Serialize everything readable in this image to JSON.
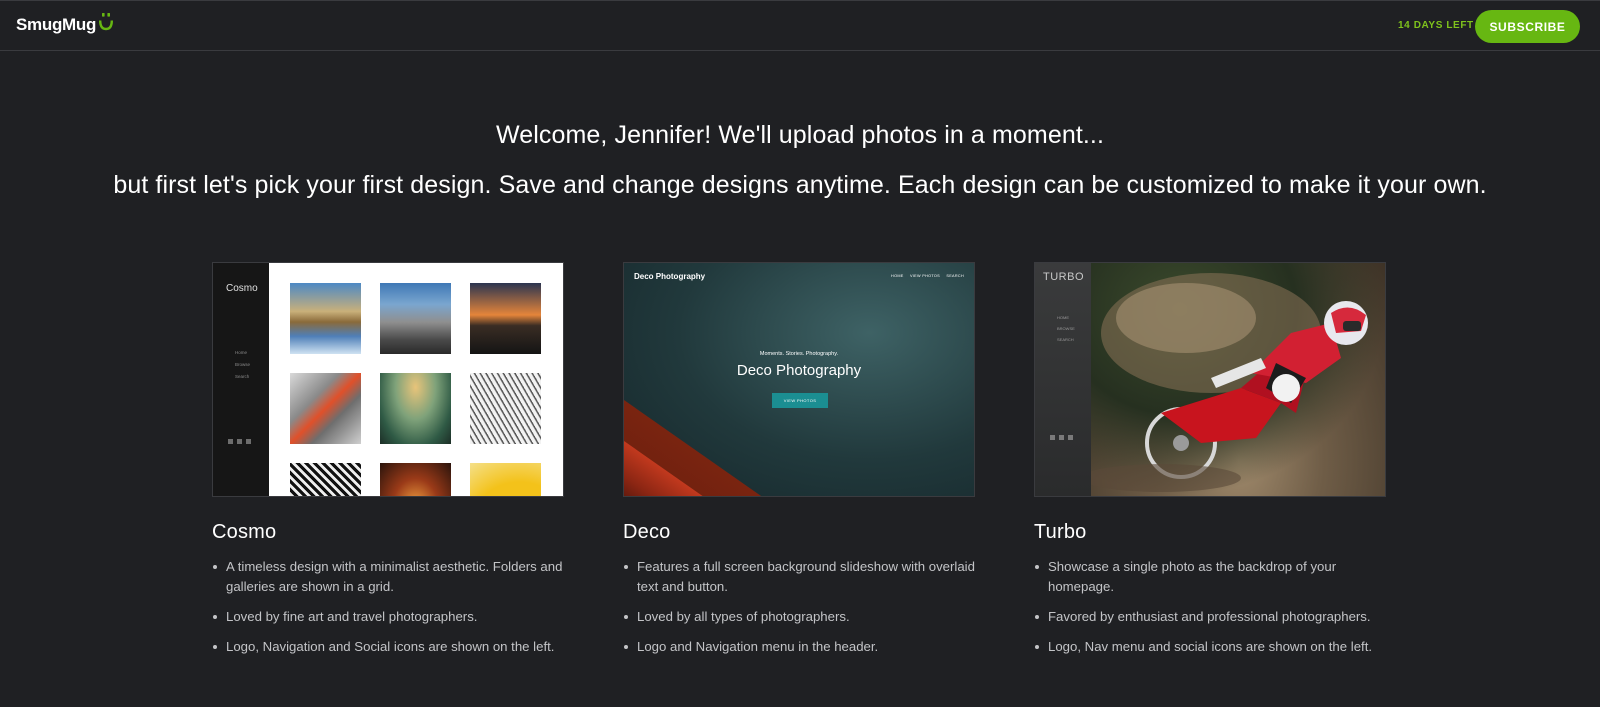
{
  "header": {
    "logo_text": "SmugMug",
    "trial_label": "14 DAYS LEFT",
    "subscribe_label": "SUBSCRIBE",
    "colors": {
      "accent": "#67b712",
      "trial_text": "#7fc31c",
      "background": "#1f2023"
    }
  },
  "welcome": {
    "line1": "Welcome, Jennifer! We'll upload photos in a moment...",
    "line2": "but first let's pick your first design. Save and change designs anytime. Each design can be customized to make it your own."
  },
  "designs": [
    {
      "name": "Cosmo",
      "preview": {
        "logo": "Cosmo",
        "nav": [
          "Home",
          "Browse",
          "Search"
        ]
      },
      "features": [
        "A timeless design with a minimalist aesthetic. Folders and galleries are shown in a grid.",
        "Loved by fine art and travel photographers.",
        "Logo, Navigation and Social icons are shown on the left."
      ]
    },
    {
      "name": "Deco",
      "preview": {
        "brand": "Deco Photography",
        "nav": [
          "HOME",
          "VIEW PHOTOS",
          "SEARCH"
        ],
        "tagline": "Moments. Stories. Photography.",
        "title": "Deco Photography",
        "button": "VIEW PHOTOS"
      },
      "features": [
        "Features a full screen background slideshow with overlaid text and button.",
        "Loved by all types of photographers.",
        "Logo and Navigation menu in the header."
      ]
    },
    {
      "name": "Turbo",
      "preview": {
        "logo": "TURBO",
        "nav": [
          "HOME",
          "BROWSE",
          "SEARCH"
        ]
      },
      "features": [
        "Showcase a single photo as the backdrop of your homepage.",
        "Favored by enthusiast and professional photographers.",
        "Logo, Nav menu and social icons are shown on the left."
      ]
    }
  ]
}
